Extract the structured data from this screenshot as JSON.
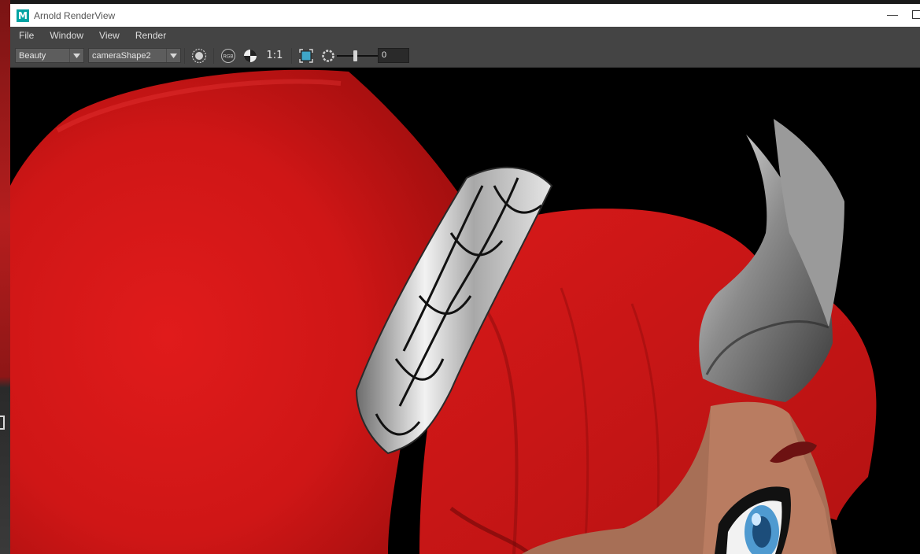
{
  "window": {
    "title": "Arnold RenderView",
    "app_icon_letter": "M",
    "minimize_glyph": "—"
  },
  "menu": [
    "File",
    "Window",
    "View",
    "Render"
  ],
  "toolbar": {
    "aov_value": "Beauty",
    "camera_value": "cameraShape2",
    "rgb_label": "RGB",
    "ratio_label": "1:1",
    "exposure_value": "0"
  },
  "icons": {
    "app": "maya-icon",
    "render_settings": "record-circle-icon",
    "channels": "rgb-icon",
    "checker": "half-contrast-icon",
    "crop_region": "crop-region-icon",
    "exposure": "aperture-icon",
    "dropdown": "chevron-down-icon"
  },
  "colors": {
    "hair_red": "#d41717",
    "background": "#000000",
    "chrome": "#444444",
    "titlebar": "#ffffff"
  }
}
